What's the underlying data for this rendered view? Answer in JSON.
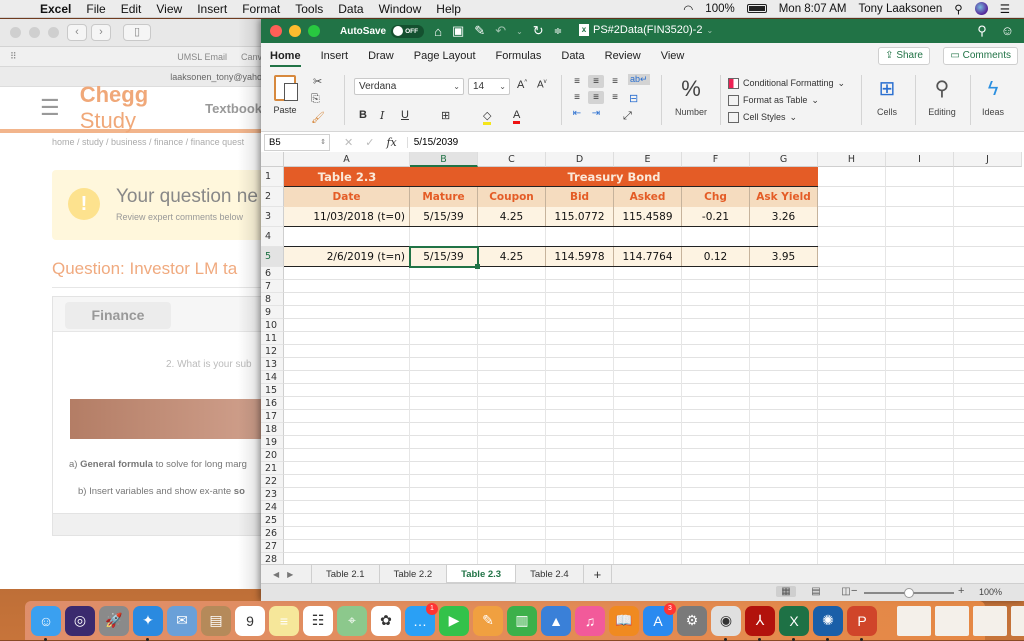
{
  "menubar": {
    "app_name": "Excel",
    "items": [
      "File",
      "Edit",
      "View",
      "Insert",
      "Format",
      "Tools",
      "Data",
      "Window",
      "Help"
    ],
    "battery": "100%",
    "clock": "Mon 8:07 AM",
    "user": "Tony Laaksonen"
  },
  "browser": {
    "bookmarks": [
      "UMSL Email",
      "Canv"
    ],
    "account": "laaksonen_tony@yaho",
    "logo_bold": "Chegg",
    "logo_light": "Study",
    "nav_textbook": "Textbook",
    "breadcrumb": "home / study / business / finance / finance quest",
    "alert_title": "Your question ne",
    "alert_sub": "Review expert comments below",
    "question_title": "Question: Investor LM ta",
    "subject_tab": "Finance",
    "subquestion": "2. What is your sub",
    "part_a_prefix": "a) ",
    "part_a_bold": "General formula",
    "part_a_rest": " to solve for long marg",
    "part_b_prefix": "b) Insert variables and show ex-ante ",
    "part_b_bold": "so"
  },
  "excel": {
    "autosave_label": "AutoSave",
    "autosave_state": "OFF",
    "doc_title": "PS#2Data(FIN3520)-2",
    "tabs": [
      "Home",
      "Insert",
      "Draw",
      "Page Layout",
      "Formulas",
      "Data",
      "Review",
      "View"
    ],
    "active_tab": "Home",
    "share_label": "Share",
    "comments_label": "Comments",
    "ribbon": {
      "paste_label": "Paste",
      "font_name": "Verdana",
      "font_size": "14",
      "number_label": "Number",
      "conditional_formatting": "Conditional Formatting",
      "format_as_table": "Format as Table",
      "cell_styles": "Cell Styles",
      "cells_label": "Cells",
      "editing_label": "Editing",
      "ideas_label": "Ideas"
    },
    "name_box": "B5",
    "formula_value": "5/15/2039",
    "columns": [
      "A",
      "B",
      "C",
      "D",
      "E",
      "F",
      "G",
      "H",
      "I",
      "J"
    ],
    "selected_column": "B",
    "selected_row": 5,
    "rows": [
      "1",
      "2",
      "3",
      "4",
      "5",
      "6",
      "7",
      "8",
      "9",
      "10",
      "11",
      "12",
      "13",
      "14",
      "15",
      "16",
      "17",
      "18",
      "19",
      "20",
      "21",
      "22",
      "23",
      "24",
      "25",
      "26",
      "27",
      "28"
    ],
    "table": {
      "title_left": "Table 2.3",
      "title_center": "Treasury Bond",
      "headers": [
        "Date",
        "Mature",
        "Coupon",
        "Bid",
        "Asked",
        "Chg",
        "Ask Yield"
      ],
      "row3": [
        "11/03/2018 (t=0)",
        "5/15/39",
        "4.25",
        "115.0772",
        "115.4589",
        "-0.21",
        "3.26"
      ],
      "row5": [
        "2/6/2019 (t=n)",
        "5/15/39",
        "4.25",
        "114.5978",
        "114.7764",
        "0.12",
        "3.95"
      ]
    },
    "sheets": [
      "Table 2.1",
      "Table 2.2",
      "Table 2.3",
      "Table 2.4"
    ],
    "active_sheet": "Table 2.3",
    "zoom": "100%",
    "zoom_percent": 100,
    "colors": {
      "accent": "#217346",
      "header_orange": "#e45c26",
      "header_beige": "#f5dcbf",
      "row_cream": "#fdf3e2"
    }
  },
  "dock": {
    "apps": [
      "Finder",
      "Siri",
      "Launchpad",
      "Safari",
      "Mail",
      "Contacts",
      "Calendar",
      "Notes",
      "Reminders",
      "Maps",
      "Photos",
      "Messages",
      "FaceTime",
      "Pages",
      "Numbers",
      "Keynote",
      "iTunes",
      "iBooks",
      "App Store",
      "System Preferences",
      "Chrome",
      "Acrobat",
      "Excel",
      "Quicktime",
      "PowerPoint"
    ],
    "calendar_day": "9",
    "messages_badge": "1",
    "appstore_badge": "3"
  }
}
